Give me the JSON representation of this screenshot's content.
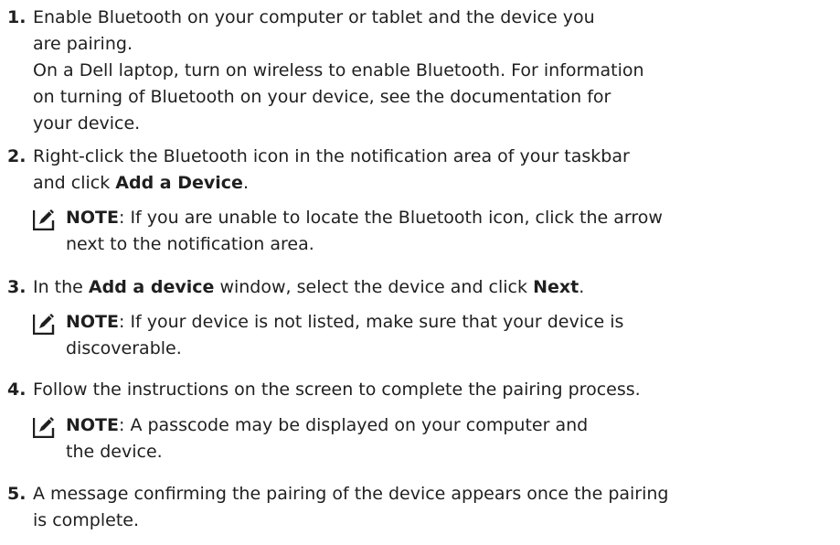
{
  "steps": [
    {
      "num": "1.",
      "l1": "Enable Bluetooth on your computer or tablet and the device you",
      "l2": "are pairing.",
      "l3": "On a Dell laptop, turn on wireless to enable Bluetooth. For information",
      "l4": "on turning of Bluetooth on your device, see the documentation for",
      "l5": "your device."
    },
    {
      "num": "2.",
      "l1": "Right-click the Bluetooth icon in the notification area of your taskbar",
      "l2a": "and click ",
      "l2b": "Add a Device",
      "l2c": ".",
      "note": {
        "label": "NOTE",
        "l1": ": If you are unable to locate the Bluetooth icon, click the arrow",
        "l2": "next to the notification area."
      }
    },
    {
      "num": "3.",
      "l1a": "In the ",
      "l1b": "Add a device",
      "l1c": " window, select the device and click ",
      "l1d": "Next",
      "l1e": ".",
      "note": {
        "label": "NOTE",
        "l1": ": If your device is not listed, make sure that your device is",
        "l2": "discoverable."
      }
    },
    {
      "num": "4.",
      "l1": "Follow the instructions on the screen to complete the pairing process.",
      "note": {
        "label": "NOTE",
        "l1": ": A passcode may be displayed on your computer and",
        "l2": "the device."
      }
    },
    {
      "num": "5.",
      "l1": "A message confirming the pairing of the device appears once the pairing",
      "l2": "is complete."
    }
  ],
  "icons": {
    "note": "note-pencil-icon"
  },
  "colors": {
    "text": "#1f1f1f"
  }
}
